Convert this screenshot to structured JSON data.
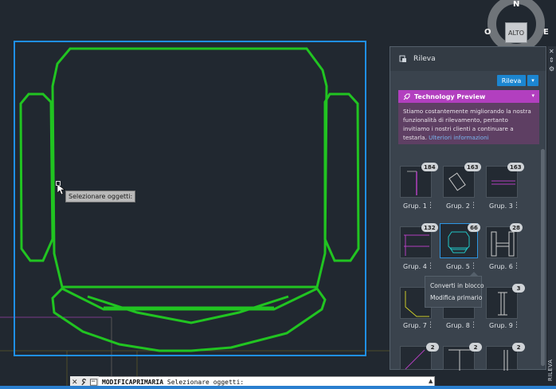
{
  "tooltip": {
    "text": "Selezionare oggetti:"
  },
  "viewcube": {
    "north": "N",
    "west": "O",
    "east": "E",
    "face": "ALTO"
  },
  "side_strip": {
    "close": "✕",
    "pin": "⇕",
    "settings": "⚙",
    "label": "RILEVA"
  },
  "panel": {
    "title": "Rileva",
    "rileva_button": "Rileva",
    "dropdown_caret": "▾",
    "tech_preview": {
      "title": "Technology Preview",
      "body": "Stiamo costantemente migliorando la nostra funzionalità di rilevamento, pertanto invitiamo i nostri clienti a continuare a testarla.",
      "link": "Ulteriori informazioni"
    },
    "groups": [
      {
        "label": "Grup. 1",
        "count": "184"
      },
      {
        "label": "Grup. 2",
        "count": "163"
      },
      {
        "label": "Grup. 3",
        "count": "163"
      },
      {
        "label": "Grup. 4",
        "count": "132"
      },
      {
        "label": "Grup. 5",
        "count": "66"
      },
      {
        "label": "Grup. 6",
        "count": "28"
      },
      {
        "label": "Grup. 7",
        "count": ""
      },
      {
        "label": "Grup. 8",
        "count": ""
      },
      {
        "label": "Grup. 9",
        "count": "3"
      },
      {
        "label": "",
        "count": "2"
      },
      {
        "label": "",
        "count": "2"
      },
      {
        "label": "",
        "count": "2"
      }
    ],
    "kebab": "⋮",
    "context_menu": [
      "Converti in blocco",
      "Modifica primario"
    ]
  },
  "cmdline": {
    "close": "✕",
    "wrench": "🔧",
    "command": "MODIFICAPRIMARIA",
    "prompt": "Selezionare oggetti:",
    "caret": "▲"
  },
  "colors": {
    "geometry": "#21c421",
    "selection": "#1f8fe6",
    "accent": "#1c86d1",
    "preview": "#b23fbf"
  }
}
